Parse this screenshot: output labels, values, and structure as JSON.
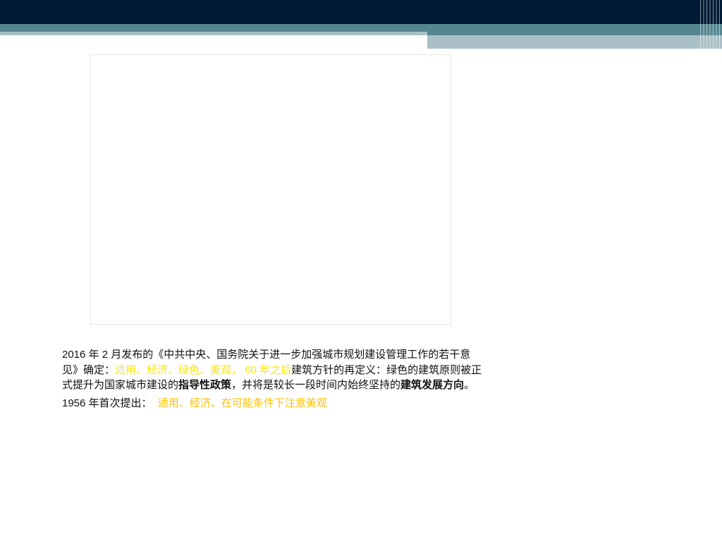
{
  "header": {
    "colors": {
      "dark": "#001a35",
      "teal": "#548690",
      "light": "#a9c1c6"
    }
  },
  "image_placeholder": {
    "label": ""
  },
  "body": {
    "p1_a": "2016 年 2 月发布的《中共中央、国务院关于进一步加强城市规划建设管理工作的若干意见》确定：",
    "p1_highlight": "适用、经济、绿色、美观，",
    "p1_highlight2": "60 年之后",
    "p1_b": "建筑方针的再定义：绿色的建筑原则被正式提升为国家城市建设的",
    "p1_bold1": "指导性政策",
    "p1_c": "，并将是较长一段时间内始终坚持的",
    "p1_bold2": "建筑发展方向",
    "p1_d": "。",
    "p2_a": "1956 年首次提出：",
    "p2_highlight": "适用、经济、在可能条件下注意美观"
  }
}
